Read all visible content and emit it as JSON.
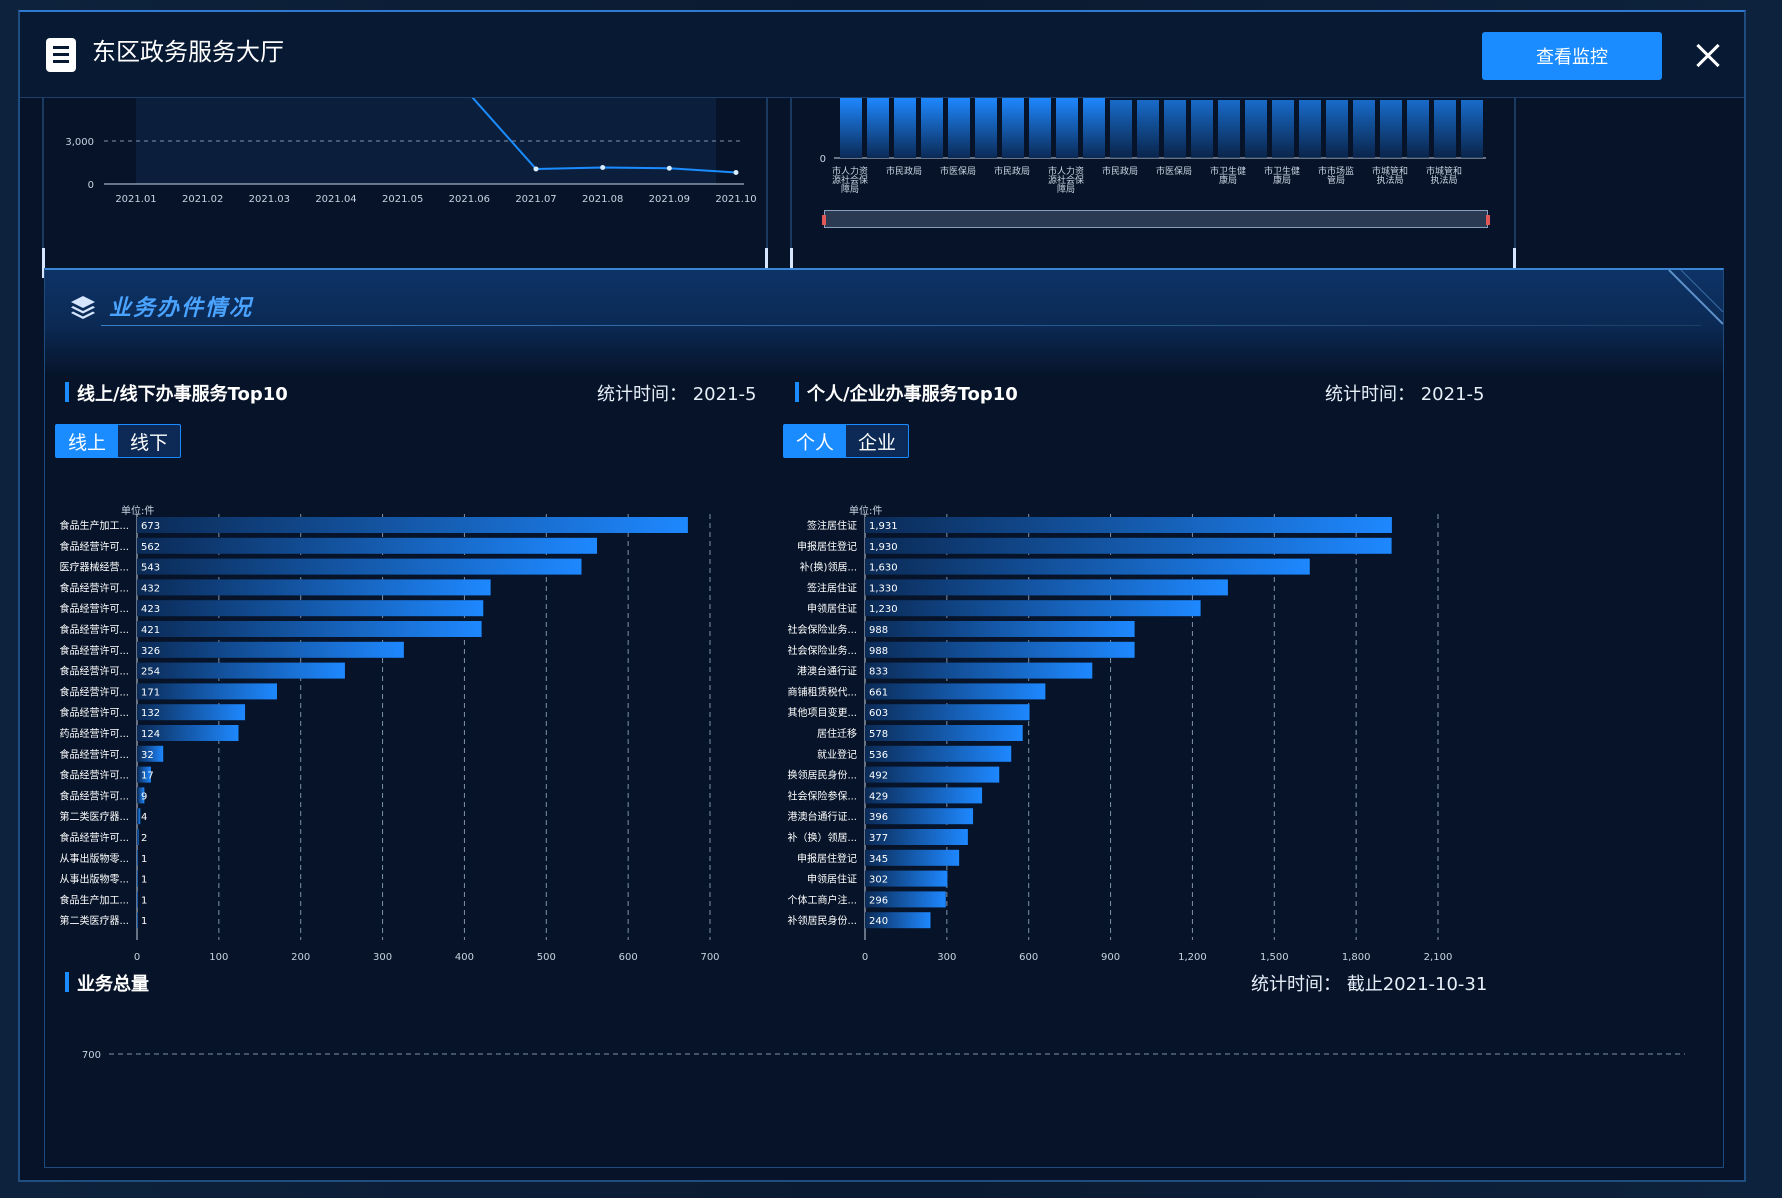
{
  "modal": {
    "title": "东区政务服务大厅",
    "monitor_label": "查看监控",
    "icons": [
      "document-icon",
      "close-icon"
    ]
  },
  "section": {
    "title": "业务办件情况",
    "icon": "layers-icon"
  },
  "left_block": {
    "title": "线上/线下办事服务Top10",
    "stat_time": "统计时间： 2021-5",
    "toggle": [
      "线上",
      "线下"
    ],
    "active_toggle": 0
  },
  "right_block": {
    "title": "个人/企业办事服务Top10",
    "stat_time": "统计时间： 2021-5",
    "toggle": [
      "个人",
      "企业"
    ],
    "active_toggle": 0
  },
  "total_block": {
    "title": "业务总量",
    "stat_time": "统计时间： 截止2021-10-31"
  },
  "colors": {
    "accent": "#1a8cff",
    "bar_end": "#1e88ff",
    "bar_start": "#0b2a55",
    "line": "#1a8cff",
    "grid": "#7f93ad"
  },
  "chart_data": [
    {
      "type": "line",
      "title": "",
      "x": [
        "2021.01",
        "2021.02",
        "2021.03",
        "2021.04",
        "2021.05",
        "2021.06",
        "2021.07",
        "2021.08",
        "2021.09",
        "2021.10"
      ],
      "y_ticks": [
        "0",
        "3,000"
      ],
      "values": [
        null,
        null,
        null,
        null,
        null,
        6500,
        1050,
        1150,
        1100,
        800
      ],
      "ylim": [
        0,
        6000
      ],
      "grid": "dashed"
    },
    {
      "type": "bar",
      "title": "",
      "y_tick": "0",
      "categories": [
        "市人力资源社会保障局",
        "市民政局",
        "市医保局",
        "市民政局",
        "市人力资源社会保障局",
        "市民政局",
        "市医保局",
        "市卫生健康局",
        "市卫生健康局",
        "市市场监管局",
        "市城管和执法局",
        "市城管和执法局"
      ],
      "has_slider": true
    },
    {
      "type": "bar",
      "orientation": "horizontal",
      "unit_label": "单位:件",
      "categories": [
        "食品生产加工...",
        "食品经营许可...",
        "医疗器械经营...",
        "食品经营许可...",
        "食品经营许可...",
        "食品经营许可...",
        "食品经营许可...",
        "食品经营许可...",
        "食品经营许可...",
        "食品经营许可...",
        "药品经营许可...",
        "食品经营许可...",
        "食品经营许可...",
        "食品经营许可...",
        "第二类医疗器...",
        "食品经营许可...",
        "从事出版物零...",
        "从事出版物零...",
        "食品生产加工...",
        "第二类医疗器..."
      ],
      "values": [
        673,
        562,
        543,
        432,
        423,
        421,
        326,
        254,
        171,
        132,
        124,
        32,
        17,
        9,
        4,
        2,
        1,
        1,
        1,
        1
      ],
      "labels": [
        "673",
        "562",
        "543",
        "432",
        "423",
        "421",
        "326",
        "254",
        "171",
        "132",
        "124",
        "32",
        "17",
        "9",
        "4",
        "2",
        "1",
        "1",
        "1",
        "1"
      ],
      "x_ticks": [
        0,
        100,
        200,
        300,
        400,
        500,
        600,
        700
      ],
      "x_tick_labels": [
        "0",
        "100",
        "200",
        "300",
        "400",
        "500",
        "600",
        "700"
      ],
      "xlim": [
        0,
        700
      ]
    },
    {
      "type": "bar",
      "orientation": "horizontal",
      "unit_label": "单位:件",
      "categories": [
        "签注居住证",
        "申报居住登记",
        "补(换)领居...",
        "签注居住证",
        "申领居住证",
        "社会保险业务...",
        "社会保险业务...",
        "港澳台通行证",
        "商铺租赁税代...",
        "其他项目变更...",
        "居住迁移",
        "就业登记",
        "换领居民身份...",
        "社会保险参保...",
        "港澳台通行证...",
        "补（换）领居...",
        "申报居住登记",
        "申领居住证",
        "个体工商户注...",
        "补领居民身份..."
      ],
      "values": [
        1931,
        1930,
        1630,
        1330,
        1230,
        988,
        988,
        833,
        661,
        603,
        578,
        536,
        492,
        429,
        396,
        377,
        345,
        302,
        296,
        240
      ],
      "labels": [
        "1,931",
        "1,930",
        "1,630",
        "1,330",
        "1,230",
        "988",
        "988",
        "833",
        "661",
        "603",
        "578",
        "536",
        "492",
        "429",
        "396",
        "377",
        "345",
        "302",
        "296",
        "240"
      ],
      "x_ticks": [
        0,
        300,
        600,
        900,
        1200,
        1500,
        1800,
        2100
      ],
      "x_tick_labels": [
        "0",
        "300",
        "600",
        "900",
        "1,200",
        "1,500",
        "1,800",
        "2,100"
      ],
      "xlim": [
        0,
        2100
      ]
    },
    {
      "type": "bar",
      "title": "",
      "y_tick": "700"
    }
  ]
}
